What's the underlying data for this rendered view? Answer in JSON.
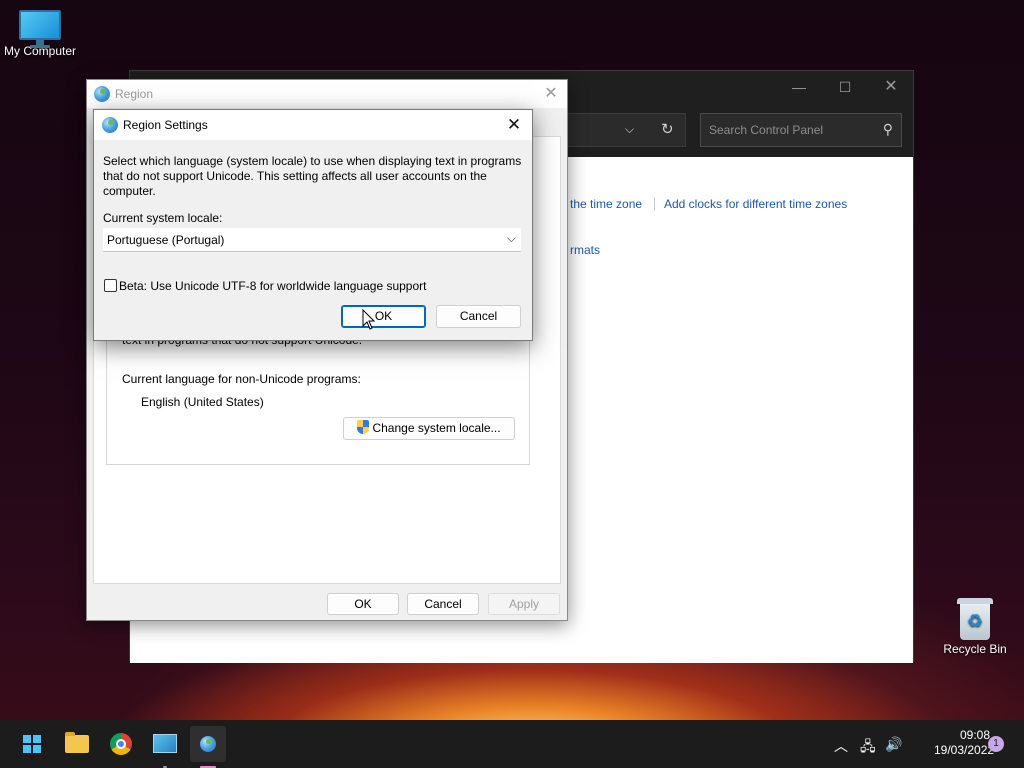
{
  "desktop": {
    "my_computer": "My Computer",
    "recycle_bin": "Recycle Bin"
  },
  "control_panel": {
    "search_placeholder": "Search Control Panel",
    "link_time_zone": "the time zone",
    "link_add_clocks": "Add clocks for different time zones",
    "link_formats": "rmats"
  },
  "region_dialog": {
    "title": "Region",
    "partial_text": "text in programs that do not support Unicode.",
    "current_language_label": "Current language for non-Unicode programs:",
    "current_language_value": "English (United States)",
    "change_locale_button": "Change system locale...",
    "ok": "OK",
    "cancel": "Cancel",
    "apply": "Apply"
  },
  "region_settings": {
    "title": "Region Settings",
    "description": "Select which language (system locale) to use when displaying text in programs that do not support Unicode. This setting affects all user accounts on the computer.",
    "locale_label": "Current system locale:",
    "locale_value": "Portuguese (Portugal)",
    "beta_checkbox_label": "Beta: Use Unicode UTF-8 for worldwide language support",
    "beta_checked": false,
    "ok": "OK",
    "cancel": "Cancel"
  },
  "taskbar": {
    "time": "09:08",
    "date": "19/03/2022",
    "notification_count": "1",
    "accent": "#4cc2ff"
  }
}
